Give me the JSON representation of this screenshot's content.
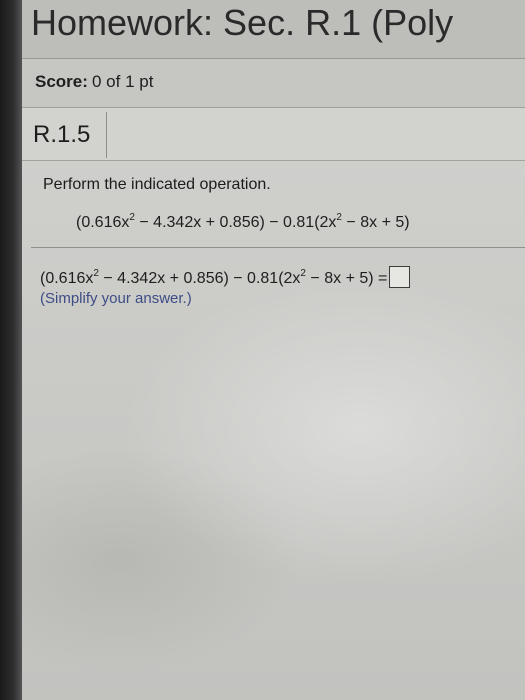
{
  "header": {
    "title": "Homework: Sec. R.1 (Poly"
  },
  "score": {
    "label": "Score:",
    "value": "0 of 1 pt"
  },
  "problem": {
    "number": "R.1.5",
    "instruction": "Perform the indicated operation.",
    "expression_parts": {
      "part1": "(0.616x",
      "exp1": "2",
      "part2": " − 4.342x + 0.856) − 0.81(2x",
      "exp2": "2",
      "part3": " − 8x + 5)"
    },
    "answer_parts": {
      "part1": "(0.616x",
      "exp1": "2",
      "part2": " − 4.342x + 0.856) − 0.81(2x",
      "exp2": "2",
      "part3": " − 8x + 5) ="
    },
    "answer_value": "",
    "hint": "(Simplify your answer.)"
  }
}
